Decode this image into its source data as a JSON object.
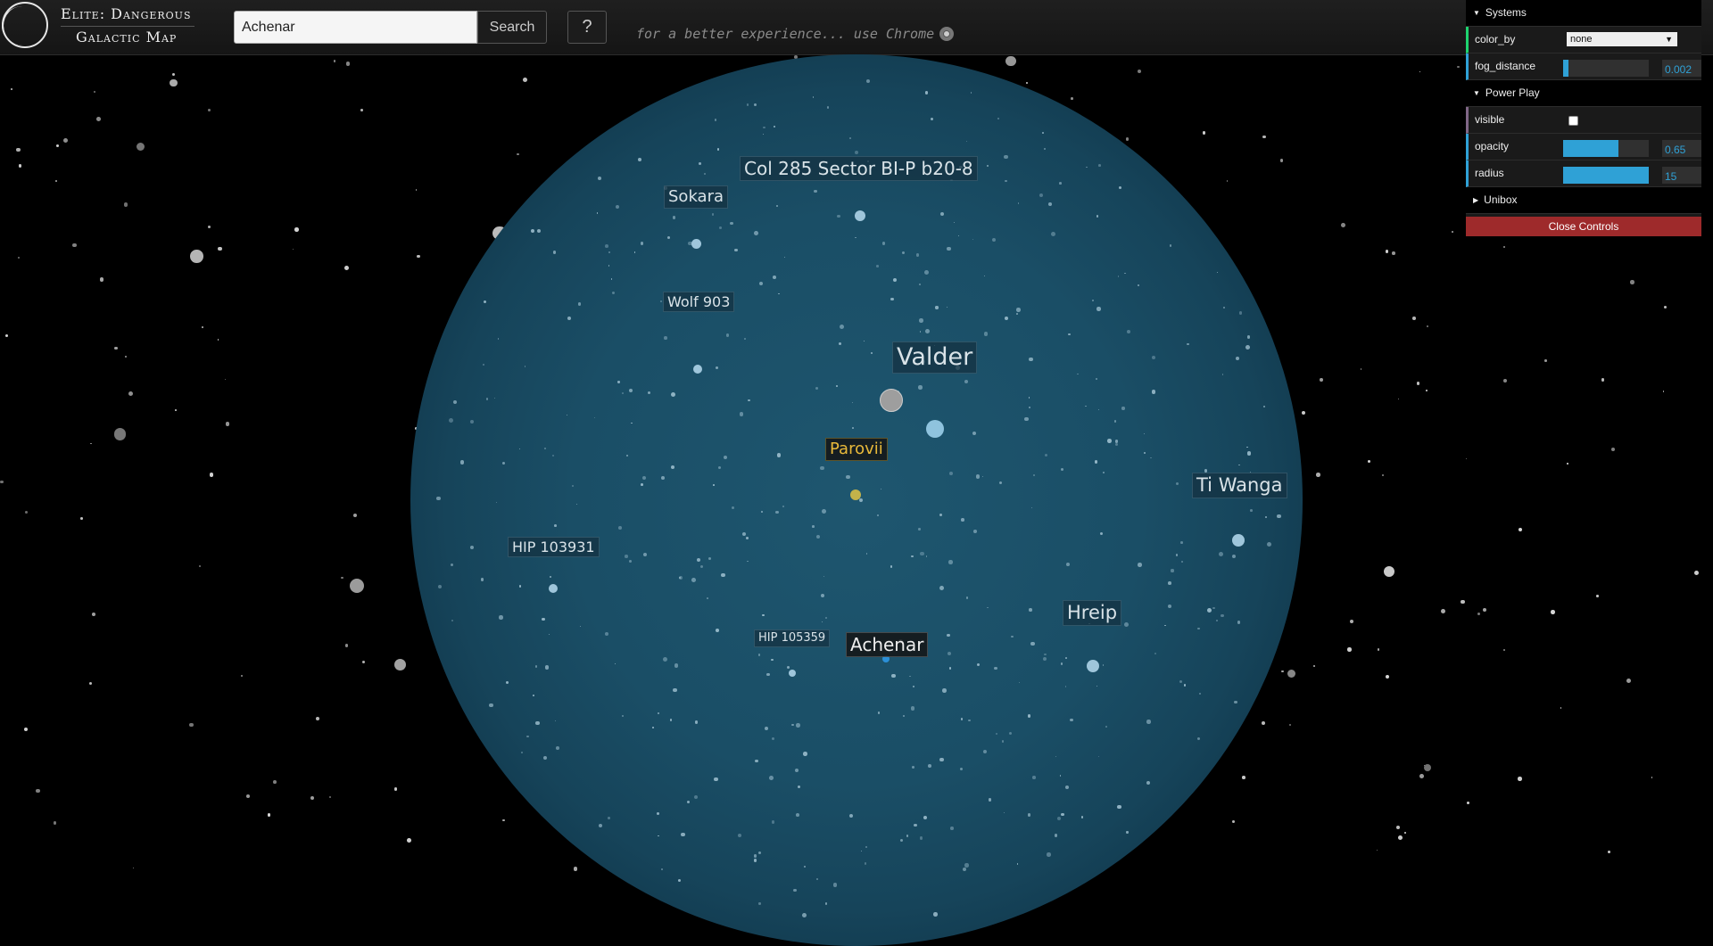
{
  "header": {
    "logo_line1": "Elite: Dangerous",
    "logo_line2": "Galactic Map",
    "search_value": "Achenar",
    "search_button": "Search",
    "help_button": "?",
    "chrome_note": "for a better experience... use Chrome"
  },
  "map": {
    "systems": [
      {
        "name": "Col 285 Sector BI-P b20-8"
      },
      {
        "name": "Sokara"
      },
      {
        "name": "Wolf 903"
      },
      {
        "name": "Valder"
      },
      {
        "name": "Parovii",
        "color": "#e8b93a"
      },
      {
        "name": "Ti Wanga"
      },
      {
        "name": "HIP 103931"
      },
      {
        "name": "Hreip"
      },
      {
        "name": "HIP 105359"
      },
      {
        "name": "Achenar",
        "color": "#2b8fd8"
      }
    ]
  },
  "controls": {
    "systems_folder": "Systems",
    "color_by_label": "color_by",
    "color_by_value": "none",
    "fog_distance_label": "fog_distance",
    "fog_distance_value": "0.002",
    "fog_distance_fill": 0.06,
    "power_play_folder": "Power Play",
    "visible_label": "visible",
    "visible_checked": false,
    "opacity_label": "opacity",
    "opacity_value": "0.65",
    "opacity_fill": 0.65,
    "radius_label": "radius",
    "radius_value": "15",
    "radius_fill": 1.0,
    "unibox_folder": "Unibox",
    "close_button": "Close Controls",
    "accent_color": "#2fa1d6",
    "close_color": "#9e2a2b"
  }
}
